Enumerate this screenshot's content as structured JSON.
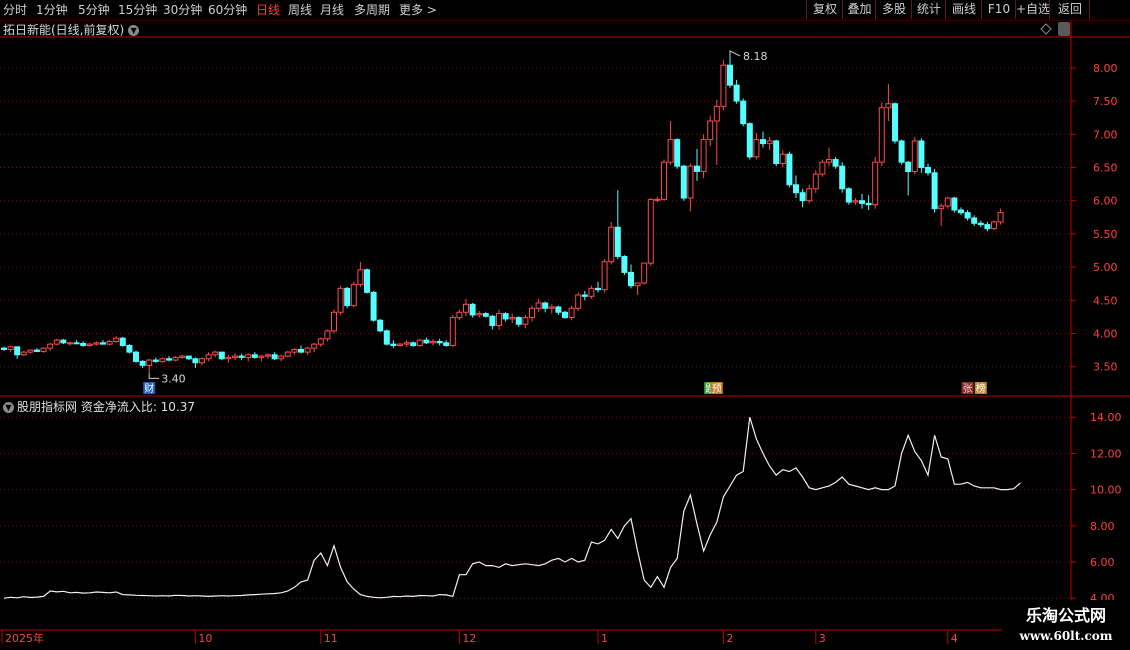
{
  "toolbar": {
    "timeframes": [
      {
        "label": "分时",
        "active": false
      },
      {
        "label": "1分钟",
        "active": false
      },
      {
        "label": "5分钟",
        "active": false
      },
      {
        "label": "15分钟",
        "active": false
      },
      {
        "label": "30分钟",
        "active": false
      },
      {
        "label": "60分钟",
        "active": false
      },
      {
        "label": "日线",
        "active": true
      },
      {
        "label": "周线",
        "active": false
      },
      {
        "label": "月线",
        "active": false
      },
      {
        "label": "多周期",
        "active": false
      },
      {
        "label": "更多 >",
        "active": false
      }
    ],
    "buttons": [
      "复权",
      "叠加",
      "多股",
      "统计",
      "画线",
      "F10",
      "+自选",
      "返回"
    ]
  },
  "chart_title": "拓日新能(日线,前复权)",
  "chart_data": [
    {
      "type": "candlestick",
      "title": "拓日新能(日线,前复权)",
      "ylim": [
        3.3,
        8.45
      ],
      "yticks": [
        "8.00",
        "7.50",
        "7.00",
        "6.50",
        "6.00",
        "5.50",
        "5.00",
        "4.50",
        "4.00",
        "3.50"
      ],
      "colors": {
        "up": "#ff4a4a",
        "down": "#54ffff",
        "grid": "#8a0000",
        "axis": "#c00000"
      },
      "max_label": "8.18",
      "min_label": "3.40",
      "ohlc": [
        [
          3.78,
          3.8,
          3.74,
          3.76
        ],
        [
          3.76,
          3.82,
          3.72,
          3.8
        ],
        [
          3.8,
          3.8,
          3.62,
          3.68
        ],
        [
          3.68,
          3.74,
          3.66,
          3.72
        ],
        [
          3.72,
          3.76,
          3.7,
          3.75
        ],
        [
          3.75,
          3.78,
          3.72,
          3.73
        ],
        [
          3.73,
          3.79,
          3.71,
          3.78
        ],
        [
          3.78,
          3.86,
          3.74,
          3.84
        ],
        [
          3.84,
          3.92,
          3.82,
          3.9
        ],
        [
          3.9,
          3.92,
          3.84,
          3.86
        ],
        [
          3.86,
          3.88,
          3.82,
          3.86
        ],
        [
          3.86,
          3.9,
          3.84,
          3.85
        ],
        [
          3.85,
          3.88,
          3.8,
          3.82
        ],
        [
          3.82,
          3.86,
          3.8,
          3.84
        ],
        [
          3.84,
          3.88,
          3.82,
          3.86
        ],
        [
          3.86,
          3.9,
          3.84,
          3.84
        ],
        [
          3.84,
          3.9,
          3.82,
          3.88
        ],
        [
          3.88,
          3.96,
          3.86,
          3.93
        ],
        [
          3.93,
          3.95,
          3.8,
          3.82
        ],
        [
          3.82,
          3.84,
          3.7,
          3.72
        ],
        [
          3.72,
          3.74,
          3.56,
          3.58
        ],
        [
          3.58,
          3.6,
          3.48,
          3.52
        ],
        [
          3.52,
          3.62,
          3.4,
          3.6
        ],
        [
          3.6,
          3.64,
          3.56,
          3.58
        ],
        [
          3.58,
          3.64,
          3.56,
          3.62
        ],
        [
          3.62,
          3.66,
          3.58,
          3.6
        ],
        [
          3.6,
          3.66,
          3.58,
          3.64
        ],
        [
          3.64,
          3.68,
          3.62,
          3.66
        ],
        [
          3.66,
          3.66,
          3.6,
          3.62
        ],
        [
          3.62,
          3.64,
          3.48,
          3.56
        ],
        [
          3.56,
          3.64,
          3.52,
          3.62
        ],
        [
          3.62,
          3.72,
          3.58,
          3.68
        ],
        [
          3.68,
          3.74,
          3.64,
          3.72
        ],
        [
          3.72,
          3.72,
          3.6,
          3.62
        ],
        [
          3.62,
          3.68,
          3.56,
          3.64
        ],
        [
          3.64,
          3.7,
          3.6,
          3.66
        ],
        [
          3.66,
          3.7,
          3.6,
          3.64
        ],
        [
          3.64,
          3.7,
          3.58,
          3.68
        ],
        [
          3.68,
          3.72,
          3.62,
          3.64
        ],
        [
          3.64,
          3.68,
          3.58,
          3.66
        ],
        [
          3.66,
          3.7,
          3.62,
          3.68
        ],
        [
          3.68,
          3.72,
          3.6,
          3.62
        ],
        [
          3.62,
          3.68,
          3.58,
          3.66
        ],
        [
          3.66,
          3.74,
          3.64,
          3.72
        ],
        [
          3.72,
          3.78,
          3.68,
          3.76
        ],
        [
          3.76,
          3.82,
          3.7,
          3.72
        ],
        [
          3.72,
          3.8,
          3.68,
          3.78
        ],
        [
          3.78,
          3.86,
          3.72,
          3.84
        ],
        [
          3.84,
          3.94,
          3.8,
          3.92
        ],
        [
          3.92,
          4.06,
          3.88,
          4.04
        ],
        [
          4.04,
          4.36,
          4.0,
          4.32
        ],
        [
          4.32,
          4.72,
          4.28,
          4.68
        ],
        [
          4.68,
          4.7,
          4.38,
          4.42
        ],
        [
          4.42,
          4.78,
          4.4,
          4.74
        ],
        [
          4.74,
          5.08,
          4.7,
          4.96
        ],
        [
          4.96,
          4.98,
          4.6,
          4.62
        ],
        [
          4.62,
          4.64,
          4.18,
          4.2
        ],
        [
          4.2,
          4.22,
          4.02,
          4.04
        ],
        [
          4.04,
          4.06,
          3.82,
          3.84
        ],
        [
          3.84,
          3.9,
          3.78,
          3.82
        ],
        [
          3.82,
          3.86,
          3.8,
          3.84
        ],
        [
          3.84,
          3.9,
          3.8,
          3.86
        ],
        [
          3.86,
          3.88,
          3.8,
          3.82
        ],
        [
          3.82,
          3.92,
          3.8,
          3.9
        ],
        [
          3.9,
          3.94,
          3.84,
          3.86
        ],
        [
          3.86,
          3.92,
          3.82,
          3.88
        ],
        [
          3.88,
          3.92,
          3.82,
          3.86
        ],
        [
          3.86,
          3.9,
          3.8,
          3.82
        ],
        [
          3.82,
          4.28,
          3.8,
          4.24
        ],
        [
          4.24,
          4.36,
          4.2,
          4.32
        ],
        [
          4.32,
          4.52,
          4.26,
          4.44
        ],
        [
          4.44,
          4.46,
          4.24,
          4.28
        ],
        [
          4.28,
          4.34,
          4.24,
          4.3
        ],
        [
          4.3,
          4.32,
          4.24,
          4.26
        ],
        [
          4.26,
          4.28,
          4.06,
          4.12
        ],
        [
          4.12,
          4.36,
          4.06,
          4.3
        ],
        [
          4.3,
          4.32,
          4.18,
          4.22
        ],
        [
          4.22,
          4.3,
          4.16,
          4.24
        ],
        [
          4.24,
          4.26,
          4.1,
          4.14
        ],
        [
          4.14,
          4.28,
          4.08,
          4.24
        ],
        [
          4.24,
          4.42,
          4.18,
          4.38
        ],
        [
          4.38,
          4.52,
          4.32,
          4.46
        ],
        [
          4.46,
          4.48,
          4.32,
          4.38
        ],
        [
          4.38,
          4.44,
          4.3,
          4.4
        ],
        [
          4.4,
          4.42,
          4.28,
          4.32
        ],
        [
          4.32,
          4.34,
          4.22,
          4.24
        ],
        [
          4.24,
          4.42,
          4.2,
          4.38
        ],
        [
          4.38,
          4.62,
          4.34,
          4.58
        ],
        [
          4.58,
          4.64,
          4.5,
          4.56
        ],
        [
          4.56,
          4.72,
          4.52,
          4.68
        ],
        [
          4.68,
          4.78,
          4.62,
          4.66
        ],
        [
          4.66,
          5.12,
          4.62,
          5.08
        ],
        [
          5.08,
          5.68,
          5.04,
          5.6
        ],
        [
          5.6,
          6.16,
          5.12,
          5.16
        ],
        [
          5.16,
          5.18,
          4.88,
          4.92
        ],
        [
          4.92,
          5.04,
          4.68,
          4.72
        ],
        [
          4.72,
          4.76,
          4.58,
          4.76
        ],
        [
          4.76,
          5.06,
          4.74,
          5.06
        ],
        [
          5.06,
          6.04,
          5.02,
          6.02
        ],
        [
          6.02,
          6.06,
          5.98,
          6.02
        ],
        [
          6.02,
          6.62,
          6.0,
          6.58
        ],
        [
          6.58,
          7.2,
          6.54,
          6.92
        ],
        [
          6.92,
          6.94,
          6.48,
          6.52
        ],
        [
          6.52,
          6.54,
          6.0,
          6.04
        ],
        [
          6.04,
          6.56,
          5.84,
          6.52
        ],
        [
          6.52,
          6.78,
          6.3,
          6.44
        ],
        [
          6.44,
          7.0,
          6.34,
          6.92
        ],
        [
          6.92,
          7.28,
          6.82,
          7.2
        ],
        [
          7.2,
          7.52,
          6.54,
          7.42
        ],
        [
          7.42,
          8.12,
          7.36,
          8.04
        ],
        [
          8.04,
          8.18,
          7.7,
          7.74
        ],
        [
          7.74,
          7.82,
          7.46,
          7.5
        ],
        [
          7.5,
          7.54,
          7.12,
          7.16
        ],
        [
          7.16,
          7.18,
          6.62,
          6.66
        ],
        [
          6.66,
          7.02,
          6.62,
          6.92
        ],
        [
          6.92,
          7.04,
          6.8,
          6.86
        ],
        [
          6.86,
          6.96,
          6.76,
          6.9
        ],
        [
          6.9,
          6.92,
          6.52,
          6.56
        ],
        [
          6.56,
          6.76,
          6.5,
          6.7
        ],
        [
          6.7,
          6.74,
          6.2,
          6.24
        ],
        [
          6.24,
          6.38,
          6.04,
          6.12
        ],
        [
          6.12,
          6.18,
          5.9,
          6.0
        ],
        [
          6.0,
          6.24,
          5.96,
          6.18
        ],
        [
          6.18,
          6.46,
          6.12,
          6.4
        ],
        [
          6.4,
          6.62,
          6.36,
          6.58
        ],
        [
          6.58,
          6.8,
          6.52,
          6.62
        ],
        [
          6.62,
          6.66,
          6.48,
          6.52
        ],
        [
          6.52,
          6.58,
          6.12,
          6.18
        ],
        [
          6.18,
          6.2,
          5.94,
          5.98
        ],
        [
          5.98,
          6.04,
          5.94,
          6.0
        ],
        [
          6.0,
          6.1,
          5.88,
          5.96
        ],
        [
          5.96,
          6.08,
          5.86,
          5.94
        ],
        [
          5.94,
          6.66,
          5.88,
          6.58
        ],
        [
          6.58,
          7.48,
          6.52,
          7.4
        ],
        [
          7.4,
          7.76,
          7.2,
          7.46
        ],
        [
          7.46,
          7.48,
          6.86,
          6.9
        ],
        [
          6.9,
          6.92,
          6.54,
          6.58
        ],
        [
          6.58,
          6.6,
          6.08,
          6.44
        ],
        [
          6.44,
          6.96,
          6.4,
          6.9
        ],
        [
          6.9,
          6.94,
          6.42,
          6.5
        ],
        [
          6.5,
          6.56,
          6.38,
          6.42
        ],
        [
          6.42,
          6.48,
          5.82,
          5.88
        ],
        [
          5.88,
          5.96,
          5.62,
          5.92
        ],
        [
          5.92,
          6.06,
          5.88,
          6.04
        ],
        [
          6.04,
          6.06,
          5.82,
          5.86
        ],
        [
          5.86,
          5.9,
          5.78,
          5.82
        ],
        [
          5.82,
          5.86,
          5.7,
          5.74
        ],
        [
          5.74,
          5.78,
          5.62,
          5.66
        ],
        [
          5.66,
          5.7,
          5.6,
          5.64
        ],
        [
          5.64,
          5.68,
          5.54,
          5.58
        ],
        [
          5.58,
          5.7,
          5.56,
          5.68
        ],
        [
          5.68,
          5.88,
          5.64,
          5.82
        ]
      ],
      "markers": [
        {
          "index": 22,
          "label": "财",
          "fill": "#1f5fbf",
          "text": "#ffffff"
        },
        {
          "index": 107,
          "label": "题",
          "fill": "#3da03d",
          "text": "#ffffff"
        },
        {
          "index": 108,
          "label": "预",
          "fill": "#c97a20",
          "text": "#ffffff"
        },
        {
          "index": 146,
          "label": "张",
          "fill": "#8a2a2a",
          "text": "#ffd0d0"
        },
        {
          "index": 148,
          "label": "榜",
          "fill": "#c08a30",
          "text": "#ffffff"
        }
      ]
    },
    {
      "type": "line",
      "title": "股朋指标网 资金净流入比: 10.37",
      "ylim": [
        3.9,
        14.4
      ],
      "yticks": [
        "14.00",
        "12.00",
        "10.00",
        "8.00",
        "6.00",
        "4.00"
      ],
      "series": [
        {
          "name": "资金净流入比",
          "color": "#f0f0f0",
          "values": [
            4.0,
            4.05,
            4.02,
            4.08,
            4.04,
            4.06,
            4.1,
            4.4,
            4.35,
            4.38,
            4.3,
            4.32,
            4.28,
            4.3,
            4.34,
            4.32,
            4.3,
            4.34,
            4.2,
            4.18,
            4.16,
            4.15,
            4.14,
            4.12,
            4.14,
            4.12,
            4.16,
            4.15,
            4.12,
            4.14,
            4.12,
            4.1,
            4.12,
            4.14,
            4.12,
            4.14,
            4.15,
            4.18,
            4.2,
            4.22,
            4.24,
            4.26,
            4.3,
            4.4,
            4.6,
            4.9,
            5.0,
            6.1,
            6.5,
            5.8,
            6.9,
            5.7,
            4.9,
            4.5,
            4.2,
            4.1,
            4.05,
            4.02,
            4.05,
            4.1,
            4.08,
            4.12,
            4.1,
            4.15,
            4.14,
            4.12,
            4.2,
            4.18,
            4.1,
            5.3,
            5.3,
            5.9,
            6.0,
            5.8,
            5.8,
            5.7,
            5.9,
            5.8,
            5.85,
            5.9,
            5.85,
            5.8,
            5.9,
            6.1,
            6.2,
            6.0,
            6.2,
            6.0,
            6.1,
            7.1,
            7.0,
            7.2,
            7.8,
            7.3,
            8.0,
            8.4,
            6.6,
            5.0,
            4.6,
            5.2,
            4.6,
            5.7,
            6.2,
            8.8,
            9.7,
            8.1,
            6.6,
            7.5,
            8.2,
            9.6,
            10.2,
            10.8,
            11.0,
            14.0,
            12.8,
            12.0,
            11.3,
            10.8,
            11.1,
            11.0,
            11.2,
            10.7,
            10.1,
            10.0,
            10.1,
            10.2,
            10.4,
            10.7,
            10.3,
            10.2,
            10.1,
            10.0,
            10.1,
            10.0,
            10.0,
            10.2,
            12.0,
            13.0,
            12.1,
            11.6,
            10.8,
            13.0,
            11.8,
            11.7,
            10.3,
            10.3,
            10.4,
            10.2,
            10.1,
            10.1,
            10.1,
            10.0,
            10.0,
            10.05,
            10.37
          ]
        }
      ]
    }
  ],
  "x_axis": {
    "labels": [
      {
        "text": "2025年",
        "index": 0
      },
      {
        "text": "10",
        "index": 29
      },
      {
        "text": "11",
        "index": 48
      },
      {
        "text": "12",
        "index": 69
      },
      {
        "text": "1",
        "index": 90
      },
      {
        "text": "2",
        "index": 109
      },
      {
        "text": "3",
        "index": 123
      },
      {
        "text": "4",
        "index": 143
      }
    ]
  },
  "watermark": {
    "line1": "乐淘公式网",
    "line2": "www.60lt.com"
  }
}
